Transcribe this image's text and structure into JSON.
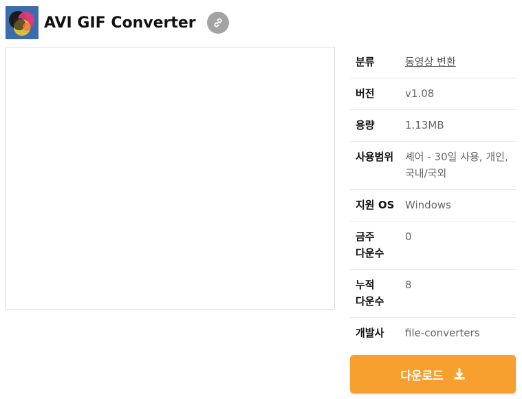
{
  "app": {
    "title": "AVI GIF Converter"
  },
  "info": {
    "rows": [
      {
        "key": "분류",
        "value": "동영상 변환"
      },
      {
        "key": "버전",
        "value": "v1.08"
      },
      {
        "key": "용량",
        "value": "1.13MB"
      },
      {
        "key": "사용범위",
        "value": "셰어 - 30일 사용, 개인, 국내/국외"
      },
      {
        "key": "지원 OS",
        "value": "Windows"
      },
      {
        "key": "금주 다운수",
        "value": "0"
      },
      {
        "key": "누적 다운수",
        "value": "8"
      },
      {
        "key": "개발사",
        "value": "file-converters"
      }
    ]
  },
  "download": {
    "label": "다운로드"
  },
  "colors": {
    "accent": "#f7a030",
    "link_button": "#a3a3a3",
    "icon_bg": "#3a6aa8"
  },
  "icons": {
    "app": "app-logo-icon",
    "share": "link-icon",
    "download": "download-icon"
  }
}
